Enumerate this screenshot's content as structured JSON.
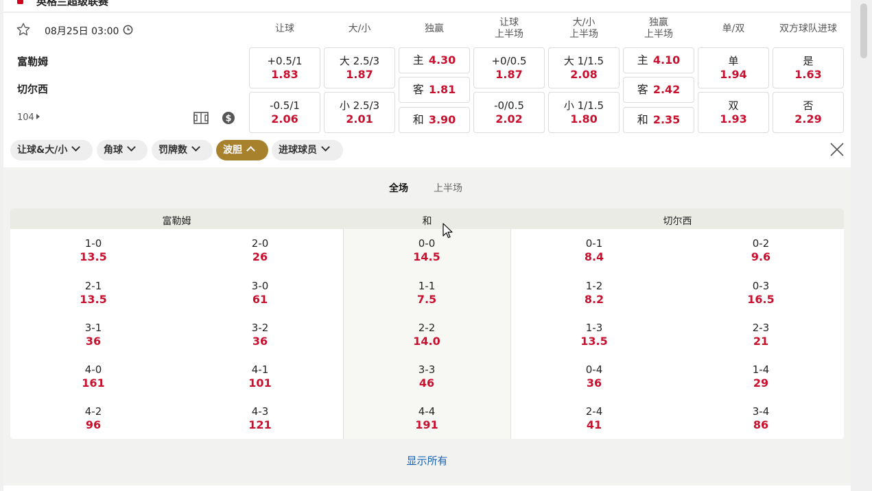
{
  "league_title": "英格兰超级联赛",
  "match": {
    "datetime": "08月25日 03:00",
    "home_team": "富勒姆",
    "away_team": "切尔西",
    "more_markets": "104"
  },
  "columns": [
    {
      "line1": "让球",
      "line2": ""
    },
    {
      "line1": "大/小",
      "line2": ""
    },
    {
      "line1": "独赢",
      "line2": ""
    },
    {
      "line1": "让球",
      "line2": "上半场"
    },
    {
      "line1": "大/小",
      "line2": "上半场"
    },
    {
      "line1": "独赢",
      "line2": "上半场"
    },
    {
      "line1": "单/双",
      "line2": ""
    },
    {
      "line1": "双方球队进球",
      "line2": ""
    }
  ],
  "odds": {
    "handicap": [
      {
        "line": "+0.5/1",
        "price": "1.83"
      },
      {
        "line": "-0.5/1",
        "price": "2.06"
      }
    ],
    "over_under": [
      {
        "line": "大 2.5/3",
        "price": "1.87"
      },
      {
        "line": "小 2.5/3",
        "price": "2.01"
      }
    ],
    "moneyline": [
      {
        "label": "主",
        "price": "4.30"
      },
      {
        "label": "客",
        "price": "1.81"
      },
      {
        "label": "和",
        "price": "3.90"
      }
    ],
    "handicap_1h": [
      {
        "line": "+0/0.5",
        "price": "1.87"
      },
      {
        "line": "-0/0.5",
        "price": "2.02"
      }
    ],
    "over_under_1h": [
      {
        "line": "大 1/1.5",
        "price": "2.08"
      },
      {
        "line": "小 1/1.5",
        "price": "1.80"
      }
    ],
    "moneyline_1h": [
      {
        "label": "主",
        "price": "4.10"
      },
      {
        "label": "客",
        "price": "2.42"
      },
      {
        "label": "和",
        "price": "2.35"
      }
    ],
    "odd_even": [
      {
        "line": "单",
        "price": "1.94"
      },
      {
        "line": "双",
        "price": "1.93"
      }
    ],
    "btts": [
      {
        "line": "是",
        "price": "1.63"
      },
      {
        "line": "否",
        "price": "2.29"
      }
    ]
  },
  "filters": [
    {
      "label": "让球&大/小",
      "active": false
    },
    {
      "label": "角球",
      "active": false
    },
    {
      "label": "罚牌数",
      "active": false
    },
    {
      "label": "波胆",
      "active": true
    },
    {
      "label": "进球球员",
      "active": false
    }
  ],
  "period_tabs": {
    "active": "全场",
    "inactive": "上半场"
  },
  "correct_score": {
    "headers": {
      "home": "富勒姆",
      "draw": "和",
      "away": "切尔西"
    },
    "home_col1": [
      {
        "score": "1-0",
        "price": "13.5"
      },
      {
        "score": "2-1",
        "price": "13.5"
      },
      {
        "score": "3-1",
        "price": "36"
      },
      {
        "score": "4-0",
        "price": "161"
      },
      {
        "score": "4-2",
        "price": "96"
      }
    ],
    "home_col2": [
      {
        "score": "2-0",
        "price": "26"
      },
      {
        "score": "3-0",
        "price": "61"
      },
      {
        "score": "3-2",
        "price": "36"
      },
      {
        "score": "4-1",
        "price": "101"
      },
      {
        "score": "4-3",
        "price": "121"
      }
    ],
    "draw": [
      {
        "score": "0-0",
        "price": "14.5"
      },
      {
        "score": "1-1",
        "price": "7.5"
      },
      {
        "score": "2-2",
        "price": "14.0"
      },
      {
        "score": "3-3",
        "price": "46"
      },
      {
        "score": "4-4",
        "price": "191"
      }
    ],
    "away_col1": [
      {
        "score": "0-1",
        "price": "8.4"
      },
      {
        "score": "1-2",
        "price": "8.2"
      },
      {
        "score": "1-3",
        "price": "13.5"
      },
      {
        "score": "0-4",
        "price": "36"
      },
      {
        "score": "2-4",
        "price": "41"
      }
    ],
    "away_col2": [
      {
        "score": "0-2",
        "price": "9.6"
      },
      {
        "score": "0-3",
        "price": "16.5"
      },
      {
        "score": "2-3",
        "price": "21"
      },
      {
        "score": "1-4",
        "price": "29"
      },
      {
        "score": "3-4",
        "price": "86"
      }
    ]
  },
  "show_all_label": "显示所有",
  "colors": {
    "odds_red": "#c8102e",
    "accent_gold": "#a8812d",
    "link_blue": "#1a62b4"
  },
  "icons": [
    "star-icon",
    "clock-icon",
    "pitch-icon",
    "dollar-icon",
    "close-icon",
    "chevron-down-icon",
    "chevron-up-icon",
    "caret-right-icon",
    "cursor-icon"
  ]
}
